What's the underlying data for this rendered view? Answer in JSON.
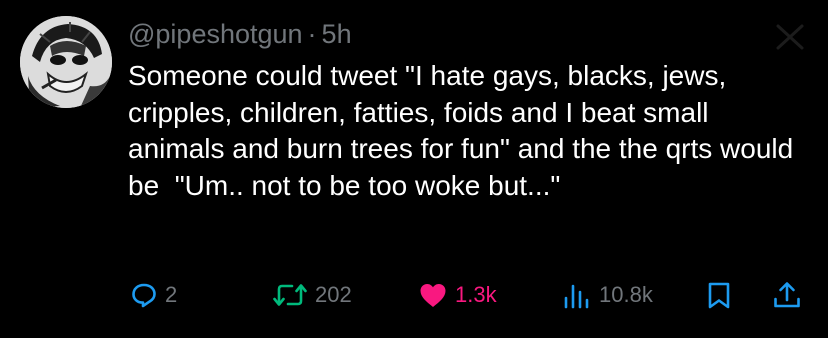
{
  "post": {
    "handle": "@pipeshotgun",
    "separator": "·",
    "time": "5h",
    "text": "Someone could tweet \"I hate gays, blacks, jews, cripples, children, fatties, foids and I beat small animals and burn trees for fun\" and the the qrts would be  \"Um.. not to be too woke but...\""
  },
  "actions": {
    "replies": "2",
    "reposts": "202",
    "likes": "1.3k",
    "views": "10.8k"
  },
  "icons": {
    "reply": "speech-bubble-icon",
    "repost": "repost-arrows-icon",
    "like": "heart-icon",
    "views": "bar-chart-icon",
    "bookmark": "bookmark-icon",
    "share": "share-upload-icon",
    "dismiss": "close-icon"
  },
  "colors": {
    "background": "#000000",
    "text": "#ffffff",
    "muted": "#71767b",
    "like": "#f91880"
  }
}
